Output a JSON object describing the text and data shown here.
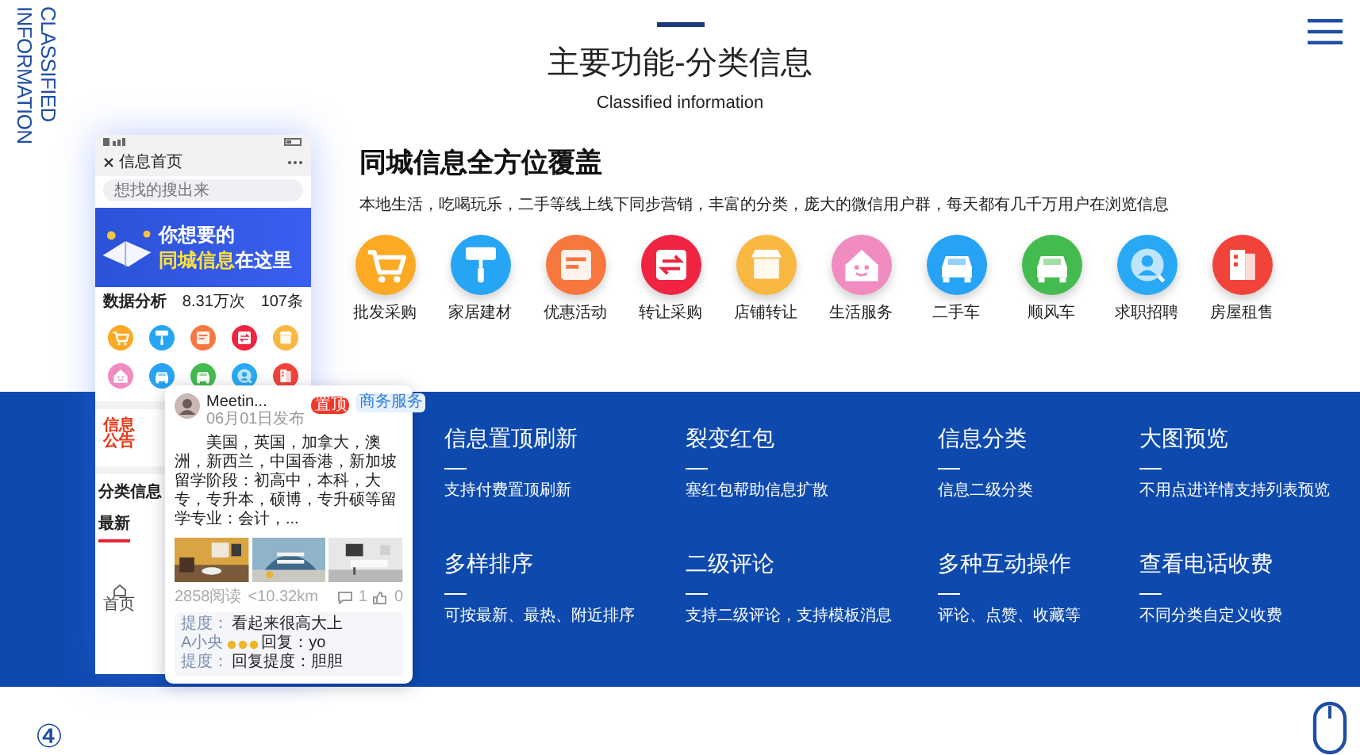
{
  "side_label": {
    "lines": [
      "CLASSIFIED",
      "INFORMATION"
    ]
  },
  "header": {
    "title": "主要功能-分类信息",
    "subtitle": "Classified information"
  },
  "intro": {
    "title": "同城信息全方位覆盖",
    "description": "本地生活，吃喝玩乐，二手等线上线下同步营销，丰富的分类，庞大的微信用户群，每天都有几千万用户在浏览信息"
  },
  "categories": [
    {
      "label": "批发采购",
      "kind": "cart",
      "color": "#fca924"
    },
    {
      "label": "家居建材",
      "kind": "roller",
      "color": "#27a5f5"
    },
    {
      "label": "优惠活动",
      "kind": "coupon",
      "color": "#f7773f"
    },
    {
      "label": "转让采购",
      "kind": "exchange",
      "color": "#ef2440"
    },
    {
      "label": "店铺转让",
      "kind": "shop",
      "color": "#f9b842"
    },
    {
      "label": "生活服务",
      "kind": "house",
      "color": "#f08cbf"
    },
    {
      "label": "二手车",
      "kind": "car",
      "color": "#26a3f4"
    },
    {
      "label": "顺风车",
      "kind": "car",
      "color": "#44bb4e"
    },
    {
      "label": "求职招聘",
      "kind": "person",
      "color": "#29a8f6"
    },
    {
      "label": "房屋租售",
      "kind": "document",
      "color": "#f2433a"
    }
  ],
  "features": [
    {
      "title": "信息置顶刷新",
      "description": "支持付费置顶刷新"
    },
    {
      "title": "裂变红包",
      "description": "塞红包帮助信息扩散"
    },
    {
      "title": "信息分类",
      "description": "信息二级分类"
    },
    {
      "title": "大图预览",
      "description": "不用点进详情支持列表预览"
    },
    {
      "title": "多样排序",
      "description": "可按最新、最热、附近排序"
    },
    {
      "title": "二级评论",
      "description": "支持二级评论，支持模板消息"
    },
    {
      "title": "多种互动操作",
      "description": "评论、点赞、收藏等"
    },
    {
      "title": "查看电话收费",
      "description": "不同分类自定义收费"
    }
  ],
  "phone": {
    "title": "信息首页",
    "search_placeholder": "想找的搜出来",
    "banner_line_1": "你想要的",
    "banner_highlight": "同城信息",
    "banner_rest": "在这里",
    "stats_title": "数据分析",
    "stats": [
      "8.31万次",
      "107条"
    ],
    "notice_logo": [
      "信息",
      "公告"
    ],
    "section_title": "分类信息",
    "tab": "最新",
    "nav_home": "首页"
  },
  "post": {
    "author": "Meetin...",
    "date": "06月01日发布",
    "badge": "置顶",
    "category": "商务服务",
    "text": "美国，英国，加拿大，澳洲，新西兰，中国香港，新加坡留学阶段：初高中，本科，大专，专升本，硕博，专升硕等留学专业：会计，...",
    "views": "2858阅读",
    "distance": "<10.32km",
    "comment_count": "1",
    "like_count": "0",
    "comments": [
      {
        "author": "提度：",
        "text": "看起来很高大上",
        "medals": false
      },
      {
        "author": "A小央",
        "text": "回复：yo",
        "medals": true
      },
      {
        "author": "提度：",
        "text": "回复提度：胆胆",
        "medals": false
      }
    ]
  },
  "footer": {
    "page_marker": "④"
  }
}
